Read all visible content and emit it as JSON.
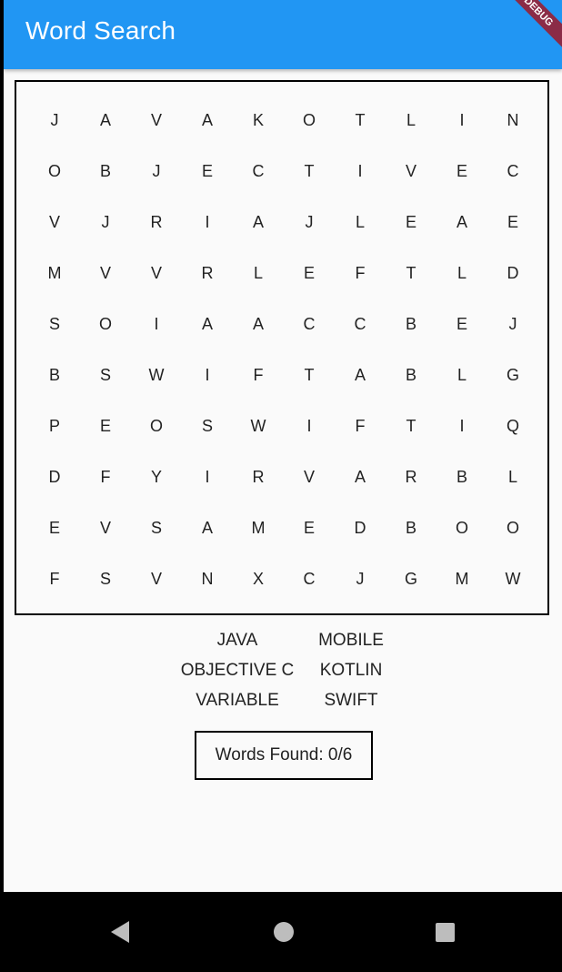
{
  "app_bar": {
    "title": "Word Search",
    "color": "#2196f3"
  },
  "debug_banner": {
    "label": "DEBUG"
  },
  "grid": [
    [
      "J",
      "A",
      "V",
      "A",
      "K",
      "O",
      "T",
      "L",
      "I",
      "N"
    ],
    [
      "O",
      "B",
      "J",
      "E",
      "C",
      "T",
      "I",
      "V",
      "E",
      "C"
    ],
    [
      "V",
      "J",
      "R",
      "I",
      "A",
      "J",
      "L",
      "E",
      "A",
      "E"
    ],
    [
      "M",
      "V",
      "V",
      "R",
      "L",
      "E",
      "F",
      "T",
      "L",
      "D"
    ],
    [
      "S",
      "O",
      "I",
      "A",
      "A",
      "C",
      "C",
      "B",
      "E",
      "J"
    ],
    [
      "B",
      "S",
      "W",
      "I",
      "F",
      "T",
      "A",
      "B",
      "L",
      "G"
    ],
    [
      "P",
      "E",
      "O",
      "S",
      "W",
      "I",
      "F",
      "T",
      "I",
      "Q"
    ],
    [
      "D",
      "F",
      "Y",
      "I",
      "R",
      "V",
      "A",
      "R",
      "B",
      "L"
    ],
    [
      "E",
      "V",
      "S",
      "A",
      "M",
      "E",
      "D",
      "B",
      "O",
      "O"
    ],
    [
      "F",
      "S",
      "V",
      "N",
      "X",
      "C",
      "J",
      "G",
      "M",
      "W"
    ]
  ],
  "words": [
    "JAVA",
    "MOBILE",
    "OBJECTIVE C",
    "KOTLIN",
    "VARIABLE",
    "SWIFT"
  ],
  "status": {
    "words_found": "Words Found: 0/6"
  },
  "nav": {
    "back_icon": "triangle-back-icon",
    "home_icon": "circle-home-icon",
    "recent_icon": "square-recent-icon"
  }
}
